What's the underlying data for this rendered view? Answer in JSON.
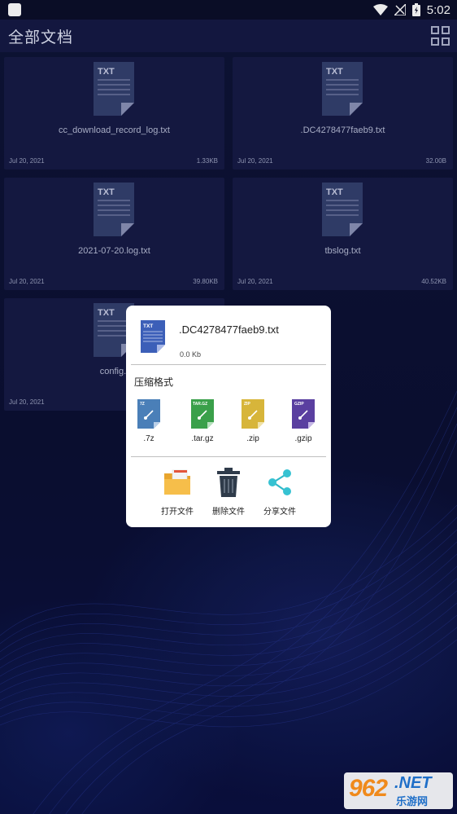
{
  "status_bar": {
    "time": "5:02"
  },
  "app_bar": {
    "title": "全部文档"
  },
  "doc_icon_label": "TXT",
  "files": [
    {
      "name": "cc_download_record_log.txt",
      "date": "Jul 20, 2021",
      "size": "1.33KB"
    },
    {
      "name": ".DC4278477faeb9.txt",
      "date": "Jul 20, 2021",
      "size": "32.00B"
    },
    {
      "name": "2021-07-20.log.txt",
      "date": "Jul 20, 2021",
      "size": "39.80KB"
    },
    {
      "name": "tbslog.txt",
      "date": "Jul 20, 2021",
      "size": "40.52KB"
    },
    {
      "name": "config.t",
      "date": "Jul 20, 2021",
      "size": ""
    }
  ],
  "dialog": {
    "file_name": ".DC4278477faeb9.txt",
    "file_size": "0.0 Kb",
    "compress_label": "压缩格式",
    "formats": [
      {
        "label": ".7z",
        "badge": "7Z",
        "color": "#4a7fb8"
      },
      {
        "label": ".tar.gz",
        "badge": "TAR.GZ",
        "color": "#3aa04a"
      },
      {
        "label": ".zip",
        "badge": "ZIP",
        "color": "#d7b53a"
      },
      {
        "label": ".gzip",
        "badge": "GZIP",
        "color": "#5a3fa0"
      }
    ],
    "actions": [
      {
        "label": "打开文件",
        "icon": "folder-icon"
      },
      {
        "label": "删除文件",
        "icon": "trash-icon"
      },
      {
        "label": "分享文件",
        "icon": "share-icon"
      }
    ]
  },
  "watermark": {
    "number": "962",
    "net": ".NET",
    "cn": "乐游网"
  },
  "colors": {
    "background": "#0d1237",
    "card": "#161b46",
    "doc_icon": "#34406f",
    "dialog_doc": "#3c5fb8"
  }
}
